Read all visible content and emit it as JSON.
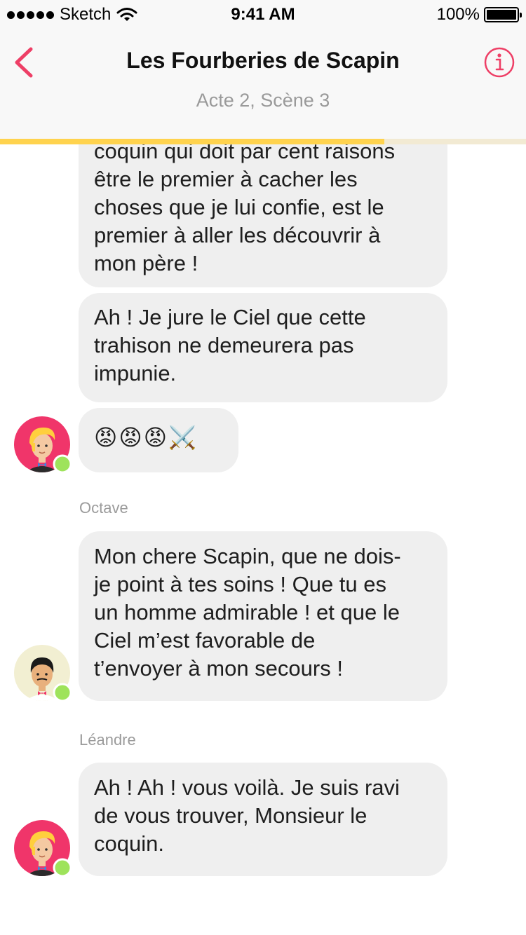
{
  "status_bar": {
    "carrier": "Sketch",
    "time": "9:41 AM",
    "battery": "100%"
  },
  "nav": {
    "title": "Les Fourberies de Scapin",
    "subtitle": "Acte 2, Scène 3",
    "back_icon": "chevron-left-icon",
    "info_icon": "info-circle-icon",
    "accent_color": "#ee3f66"
  },
  "progress": {
    "value": 0.73,
    "color": "#ffd34e",
    "track_color": "#f2ead3"
  },
  "messages": [
    {
      "text": "coquin qui doit par cent raisons\nêtre le premier à cacher les\nchoses que je lui confie, est le\npremier à aller les découvrir à\nmon père !"
    },
    {
      "text": "Ah ! Je jure le Ciel que cette\ntrahison ne demeurera pas\nimpunie."
    },
    {
      "text": "😡😡😡⚔️"
    },
    {
      "sender": "Octave",
      "text": "Mon chere Scapin, que ne dois-\nje point à tes soins ! Que tu es\nun homme admirable ! et que le\nCiel m’est favorable de\nt’envoyer à mon secours !"
    },
    {
      "sender": "Léandre",
      "text": "Ah ! Ah ! vous voilà. Je suis ravi\nde vous trouver, Monsieur le\ncoquin."
    }
  ],
  "presence_color": "#9ee35b"
}
